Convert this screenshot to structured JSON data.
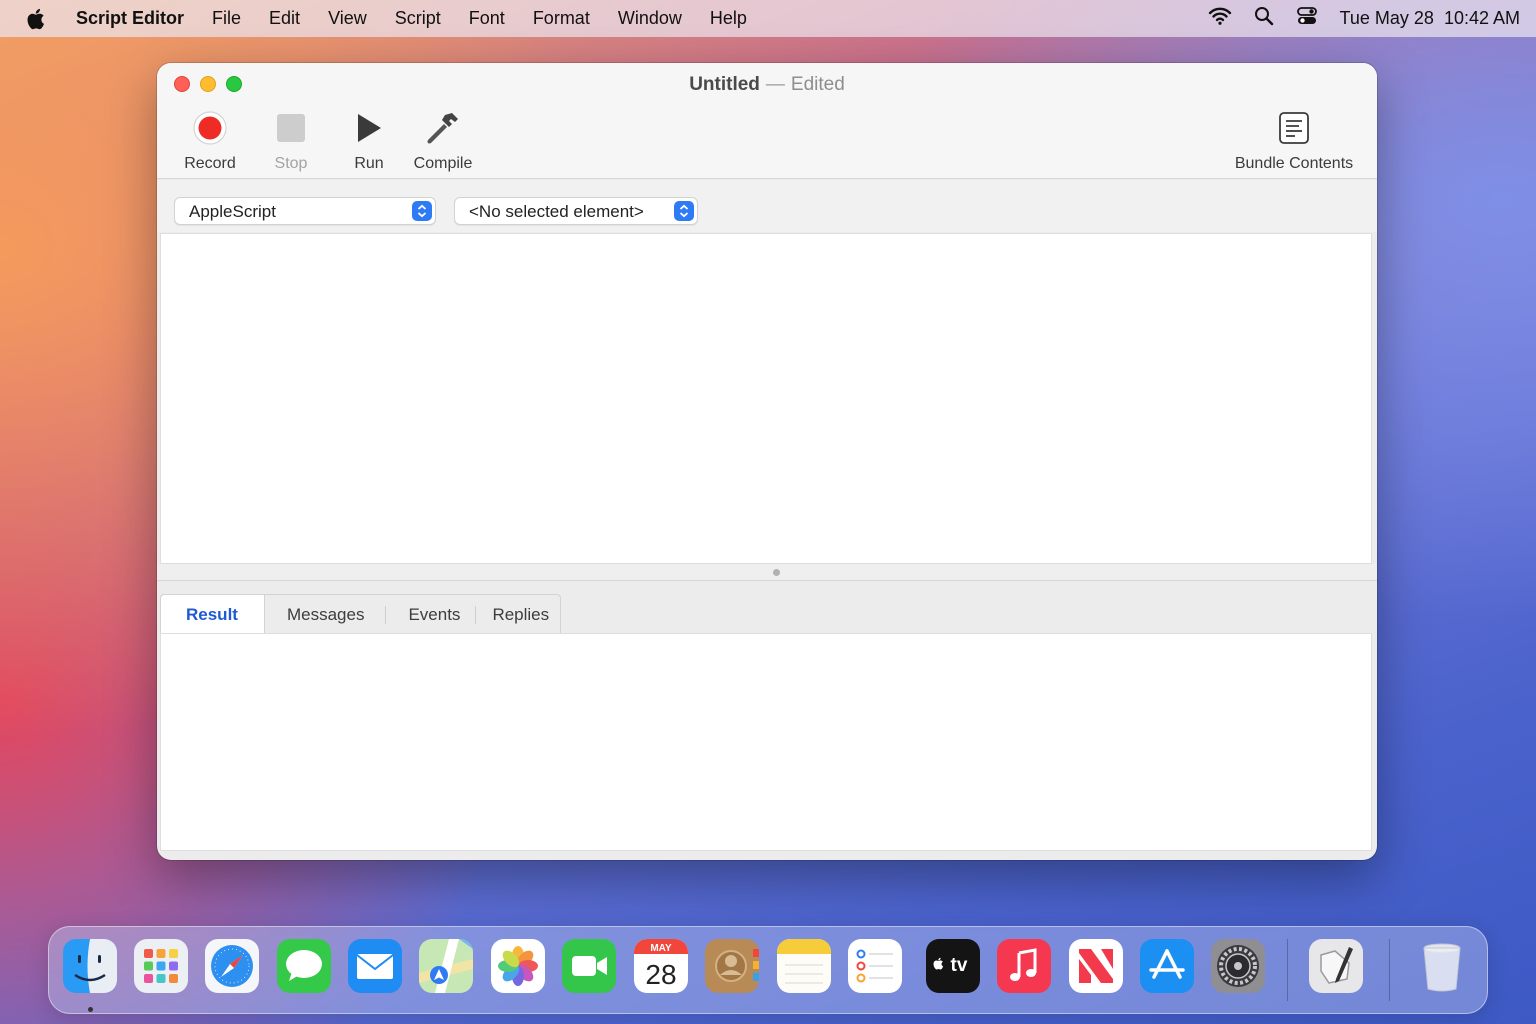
{
  "menubar": {
    "app_name": "Script Editor",
    "items": [
      "File",
      "Edit",
      "View",
      "Script",
      "Font",
      "Format",
      "Window",
      "Help"
    ],
    "date": "Tue May 28",
    "time": "10:42 AM"
  },
  "window": {
    "title": "Untitled",
    "title_separator": "—",
    "title_status": "Edited"
  },
  "toolbar": {
    "record": "Record",
    "stop": "Stop",
    "run": "Run",
    "compile": "Compile",
    "bundle_contents": "Bundle Contents"
  },
  "selectors": {
    "language": "AppleScript",
    "element": "<No selected element>"
  },
  "tabs": [
    "Result",
    "Messages",
    "Events",
    "Replies"
  ],
  "dock": {
    "calendar_month": "MAY",
    "calendar_day": "28",
    "tv_label": "tv"
  },
  "colors": {
    "accent": "#2f7bf5",
    "record": "#ee2b24",
    "active_tab_text": "#1e5ad6"
  }
}
